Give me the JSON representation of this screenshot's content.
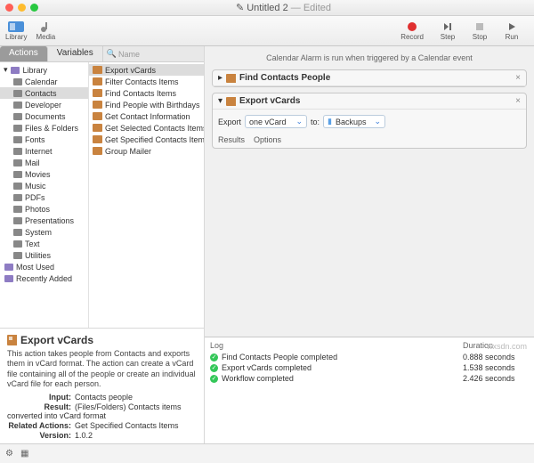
{
  "title": "Untitled 2",
  "title_status": "— Edited",
  "toolbar": {
    "library": "Library",
    "media": "Media",
    "record": "Record",
    "step": "Step",
    "stop": "Stop",
    "run": "Run"
  },
  "tabs": {
    "actions": "Actions",
    "variables": "Variables"
  },
  "search": {
    "placeholder": "Name"
  },
  "library": {
    "root": "Library",
    "items": [
      "Calendar",
      "Contacts",
      "Developer",
      "Documents",
      "Files & Folders",
      "Fonts",
      "Internet",
      "Mail",
      "Movies",
      "Music",
      "PDFs",
      "Photos",
      "Presentations",
      "System",
      "Text",
      "Utilities"
    ],
    "selected": "Contacts",
    "bottom": [
      "Most Used",
      "Recently Added"
    ]
  },
  "actions_list": [
    "Export vCards",
    "Filter Contacts Items",
    "Find Contacts Items",
    "Find People with Birthdays",
    "Get Contact Information",
    "Get Selected Contacts Items",
    "Get Specified Contacts Items",
    "Group Mailer"
  ],
  "actions_selected": "Export vCards",
  "description": {
    "title": "Export vCards",
    "body": "This action takes people from Contacts and exports them in vCard format. The action can create a vCard file containing all of the people or create an individual vCard file for each person.",
    "input": "Contacts people",
    "result": "(Files/Folders) Contacts items converted into vCard format",
    "related": "Get Specified Contacts Items",
    "version": "1.0.2"
  },
  "workflow": {
    "hint": "Calendar Alarm is run when triggered by a Calendar event",
    "a1": {
      "title": "Find Contacts People"
    },
    "a2": {
      "title": "Export vCards",
      "export_label": "Export",
      "format": "one vCard",
      "to_label": "to:",
      "dest": "Backups",
      "tabs": [
        "Results",
        "Options"
      ]
    }
  },
  "log": {
    "h_log": "Log",
    "h_dur": "Duration",
    "rows": [
      {
        "msg": "Find Contacts People completed",
        "dur": "0.888 seconds"
      },
      {
        "msg": "Export vCards completed",
        "dur": "1.538 seconds"
      },
      {
        "msg": "Workflow completed",
        "dur": "2.426 seconds"
      }
    ]
  },
  "watermark": "wxsdn.com"
}
